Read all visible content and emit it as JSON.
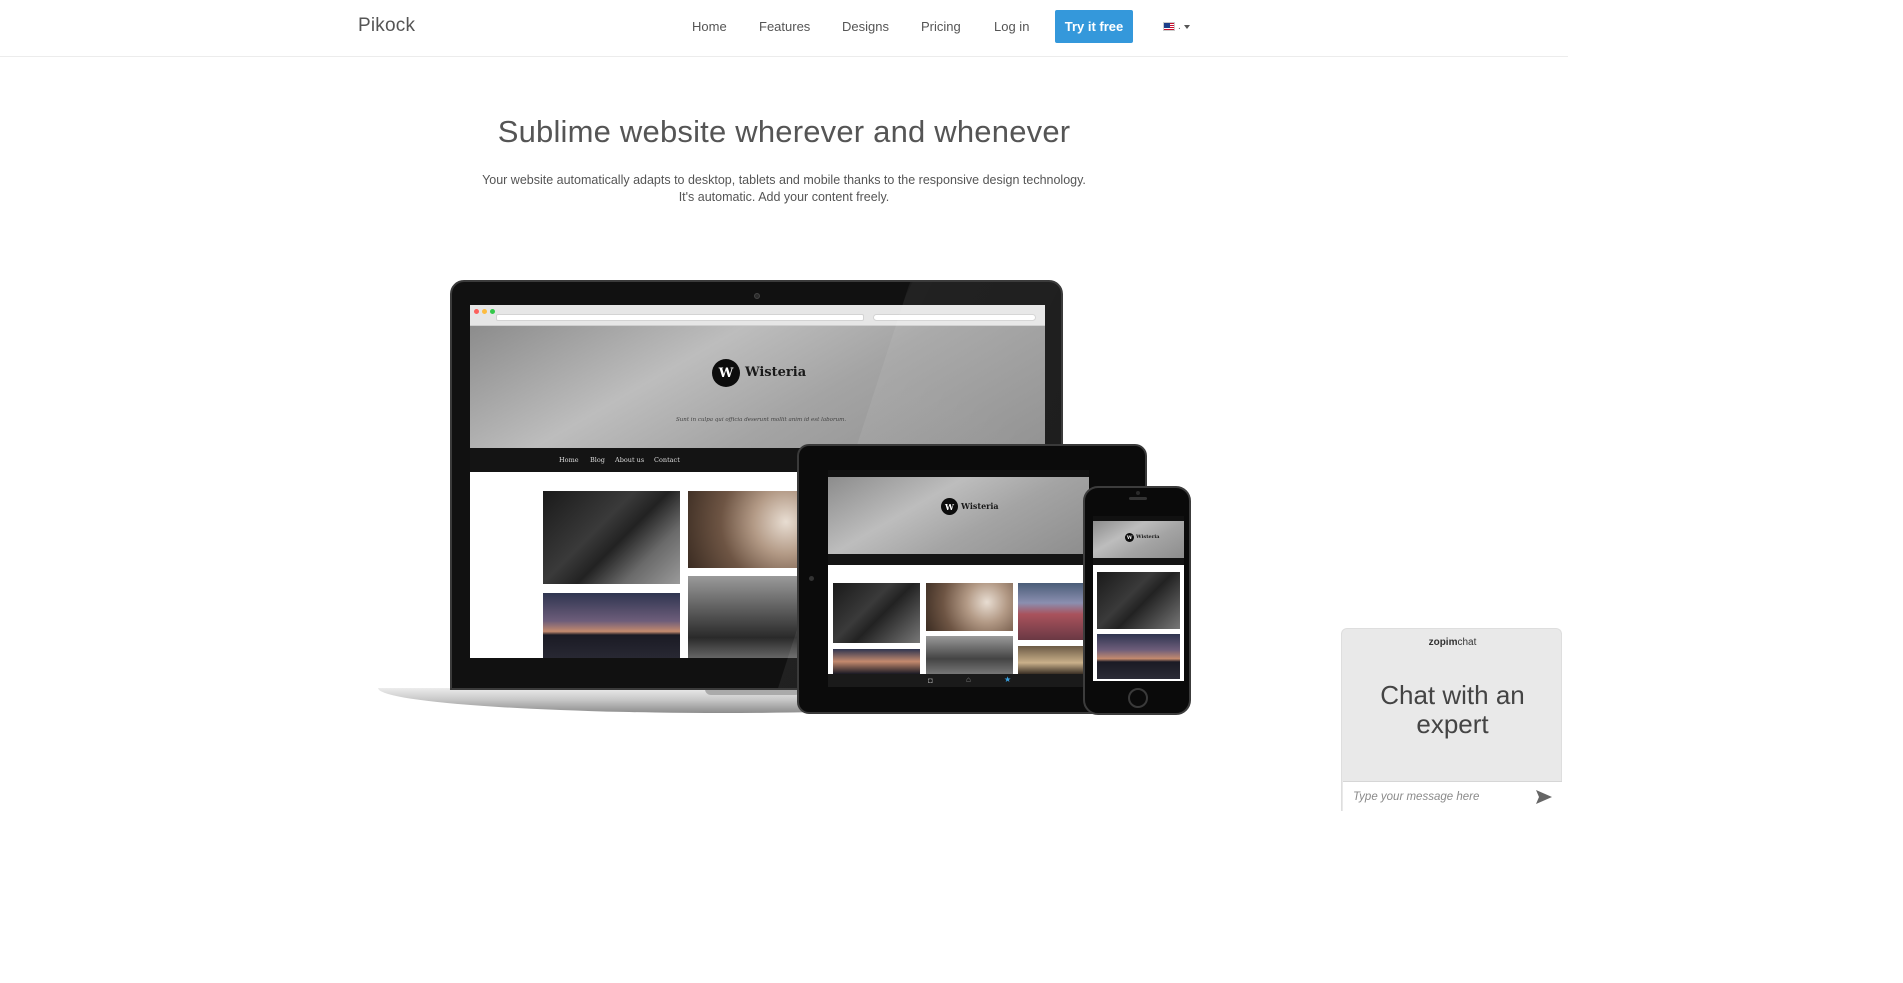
{
  "navbar": {
    "brand": "Pikock",
    "links": [
      "Home",
      "Features",
      "Designs",
      "Pricing",
      "Log in"
    ],
    "cta": "Try it free",
    "language": {
      "icon": "us-flag-icon",
      "label": "."
    }
  },
  "hero": {
    "title": "Sublime website wherever and whenever",
    "subtitle_line1": "Your website automatically adapts to desktop, tablets and mobile thanks to the responsive design technology.",
    "subtitle_line2": "It's automatic. Add your content freely."
  },
  "showcase": {
    "site_name": "Wisteria",
    "logo_letter": "W",
    "tagline": "Sunt in culpa qui officia deserunt mollit anim id est laborum.",
    "site_nav": [
      "Home",
      "Blog",
      "About us",
      "Contact"
    ]
  },
  "chat": {
    "brand_a": "zopim",
    "brand_b": "chat",
    "title": "Chat with an expert",
    "placeholder": "Type your message here",
    "send_icon": "send-icon"
  },
  "colors": {
    "accent": "#3498db",
    "text": "#555555",
    "chat_bg": "#e9e9e9"
  }
}
